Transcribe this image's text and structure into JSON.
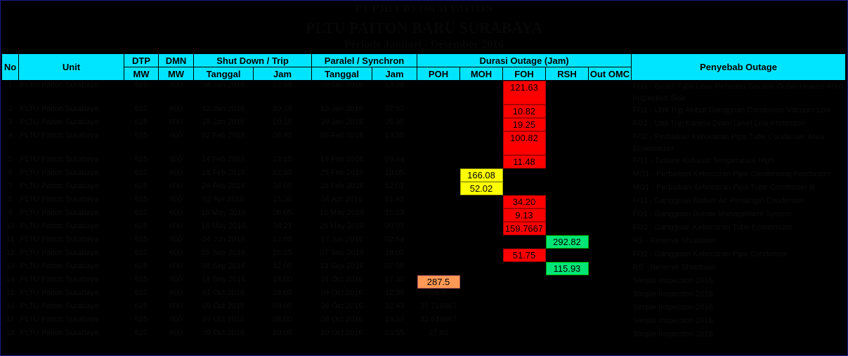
{
  "titles": {
    "line1": "PT PJB UBJ O&M PAITON",
    "line2": "PLTU PAITON BARU SURABAYA",
    "line3": "Periode Januari - Desember 2016"
  },
  "header": {
    "no": "No",
    "unit": "Unit",
    "dtp": "DTP",
    "dmn": "DMN",
    "mw": "MW",
    "shutdown": "Shut Down / Trip",
    "paralel": "Paralel / Synchron",
    "durasi": "Durasi Outage (Jam)",
    "penyebab": "Penyebab Outage",
    "tanggal": "Tanggal",
    "jam": "Jam",
    "poh": "POH",
    "moh": "MOH",
    "foh": "FOH",
    "rsh": "RSH",
    "omc": "Out OMC"
  },
  "rows": [
    {
      "no": "1",
      "unit": "PLTU Paiton Surabaya",
      "dtp": "625",
      "dmn": "600",
      "sd_date": "04 Jan 2016",
      "sd_time": "12:00",
      "pa_date": "09 Jan 2016",
      "pa_time": "13:38",
      "poh": "",
      "moh": "",
      "foh": "121.63",
      "rsh": "",
      "omc": "",
      "cause": "FO1 - Boiler Tube Leak Reheater Section Outlet Header Area Inspection Side",
      "tall": true
    },
    {
      "no": "2",
      "unit": "PLTU Paiton Surabaya",
      "dtp": "625",
      "dmn": "600",
      "sd_date": "12 Jan 2016",
      "sd_time": "20:18",
      "pa_date": "13 Jan 2016",
      "pa_time": "07:07",
      "poh": "",
      "moh": "",
      "foh": "10.82",
      "rsh": "",
      "omc": "",
      "cause": "FO1 - Unit Trip Akibat Gangguan Condenser Vacuum Low",
      "tall": false
    },
    {
      "no": "3",
      "unit": "PLTU Paiton Surabaya",
      "dtp": "625",
      "dmn": "600",
      "sd_date": "28 Jan 2016",
      "sd_time": "10:15",
      "pa_date": "29 Jan 2016",
      "pa_time": "05:30",
      "poh": "",
      "moh": "",
      "foh": "19.25",
      "rsh": "",
      "omc": "",
      "cause": "FO1 - Unit Trip Karena Drum Level Low Protection",
      "tall": false
    },
    {
      "no": "4",
      "unit": "PLTU Paiton Surabaya",
      "dtp": "625",
      "dmn": "600",
      "sd_date": "02 Feb 2016",
      "sd_time": "08:47",
      "pa_date": "06 Feb 2016",
      "pa_time": "13:36",
      "poh": "",
      "moh": "",
      "foh": "100.82",
      "rsh": "",
      "omc": "",
      "cause": "FO2 - Perbaikan Kebocoran Pipa Tube Condenser Area Economizer",
      "tall": true
    },
    {
      "no": "5",
      "unit": "PLTU Paiton Surabaya",
      "dtp": "625",
      "dmn": "600",
      "sd_date": "14 Feb 2016",
      "sd_time": "22:15",
      "pa_date": "15 Feb 2016",
      "pa_time": "09:44",
      "poh": "",
      "moh": "",
      "foh": "11.48",
      "rsh": "",
      "omc": "",
      "cause": "FO1 - Turbine Exhaust Temperature High",
      "tall": false
    },
    {
      "no": "6",
      "unit": "PLTU Paiton Surabaya",
      "dtp": "625",
      "dmn": "600",
      "sd_date": "18 Feb 2016",
      "sd_time": "12:00",
      "pa_date": "25 Feb 2016",
      "pa_time": "10:05",
      "poh": "",
      "moh": "166.08",
      "foh": "",
      "rsh": "",
      "omc": "",
      "cause": "MO1 - Perbaikan Kebocoran Pipa Condensing Feedwater",
      "tall": false
    },
    {
      "no": "7",
      "unit": "PLTU Paiton Surabaya",
      "dtp": "625",
      "dmn": "600",
      "sd_date": "26 Feb 2016",
      "sd_time": "08:00",
      "pa_date": "28 Feb 2016",
      "pa_time": "12:01",
      "poh": "",
      "moh": "52.02",
      "foh": "",
      "rsh": "",
      "omc": "",
      "cause": "MO1 - Perbaikan Kebocoran Pipa Tube Condenser B",
      "tall": false
    },
    {
      "no": "8",
      "unit": "PLTU Paiton Surabaya",
      "dtp": "625",
      "dmn": "600",
      "sd_date": "02 Apr 2016",
      "sd_time": "15:30",
      "pa_date": "04 Apr 2016",
      "pa_time": "01:42",
      "poh": "",
      "moh": "",
      "foh": "34.20",
      "rsh": "",
      "omc": "",
      "cause": "FO1 - Gangguan Sistem Air Pendingin Condenser",
      "tall": false
    },
    {
      "no": "9",
      "unit": "PLTU Paiton Surabaya",
      "dtp": "625",
      "dmn": "600",
      "sd_date": "10 May 2016",
      "sd_time": "06:05",
      "pa_date": "10 May 2016",
      "pa_time": "15:13",
      "poh": "",
      "moh": "",
      "foh": "9.13",
      "rsh": "",
      "omc": "",
      "cause": "FO1 - Gangguan Burner Management System",
      "tall": false
    },
    {
      "no": "10",
      "unit": "PLTU Paiton Surabaya",
      "dtp": "625",
      "dmn": "600",
      "sd_date": "18 May 2016",
      "sd_time": "08:21",
      "pa_date": "25 May 2016",
      "pa_time": "00:07",
      "poh": "",
      "moh": "",
      "foh": "159.7667",
      "rsh": "",
      "omc": "",
      "cause": "FO2 - Gangguan Kebocoran Tube Economizer",
      "tall": false
    },
    {
      "no": "11",
      "unit": "PLTU Paiton Surabaya",
      "dtp": "625",
      "dmn": "600",
      "sd_date": "04 Jun 2016",
      "sd_time": "22:05",
      "pa_date": "17 Jun 2016",
      "pa_time": "02:54",
      "poh": "",
      "moh": "",
      "foh": "",
      "rsh": "292.82",
      "omc": "",
      "cause": "RS - Reserve Shutdown",
      "tall": false
    },
    {
      "no": "12",
      "unit": "PLTU Paiton Surabaya",
      "dtp": "625",
      "dmn": "600",
      "sd_date": "05 Sep 2016",
      "sd_time": "15:15",
      "pa_date": "07 Sep 2016",
      "pa_time": "19:00",
      "poh": "",
      "moh": "",
      "foh": "51.75",
      "rsh": "",
      "omc": "",
      "cause": "FO2 - Gangguan Kebocoran Pipa Condenser",
      "tall": false
    },
    {
      "no": "13",
      "unit": "PLTU Paiton Surabaya",
      "dtp": "625",
      "dmn": "600",
      "sd_date": "08 Sep 2016",
      "sd_time": "12:00",
      "pa_date": "13 Sep 2016",
      "pa_time": "07:56",
      "poh": "",
      "moh": "",
      "foh": "",
      "rsh": "115.93",
      "omc": "",
      "cause": "RS - Reserve Shutdown",
      "tall": false
    },
    {
      "no": "14",
      "unit": "PLTU Paiton Surabaya",
      "dtp": "625",
      "dmn": "600",
      "sd_date": "19 Sep 2016",
      "sd_time": "18:00",
      "pa_date": "01 Oct 2016",
      "pa_time": "17:30",
      "poh": "287.5",
      "moh": "",
      "foh": "",
      "rsh": "",
      "omc": "",
      "cause": "Simple Inspection 2016",
      "tall": false
    },
    {
      "no": "15",
      "unit": "PLTU Paiton Surabaya",
      "dtp": "625",
      "dmn": "600",
      "sd_date": "01 Oct 2016",
      "sd_time": "18:00",
      "pa_date": "04 Oct 2016",
      "pa_time": "12:36",
      "poh": "66.6",
      "moh": "",
      "foh": "",
      "rsh": "",
      "omc": "",
      "cause": "Simple Inspection 2016",
      "tall": false
    },
    {
      "no": "16",
      "unit": "PLTU Paiton Surabaya",
      "dtp": "625",
      "dmn": "600",
      "sd_date": "05 Oct 2016",
      "sd_time": "09:00",
      "pa_date": "06 Oct 2016",
      "pa_time": "22:43",
      "poh": "37.716667",
      "moh": "",
      "foh": "",
      "rsh": "",
      "omc": "",
      "cause": "Simple Inspection 2016",
      "tall": false
    },
    {
      "no": "17",
      "unit": "PLTU Paiton Surabaya",
      "dtp": "625",
      "dmn": "600",
      "sd_date": "07 Oct 2016",
      "sd_time": "08:00",
      "pa_date": "08 Oct 2016",
      "pa_time": "16:37",
      "poh": "32.616667",
      "moh": "",
      "foh": "",
      "rsh": "",
      "omc": "",
      "cause": "Simple Inspection 2016",
      "tall": false
    },
    {
      "no": "18",
      "unit": "PLTU Paiton Surabaya",
      "dtp": "625",
      "dmn": "600",
      "sd_date": "09 Oct 2016",
      "sd_time": "10:00",
      "pa_date": "10 Oct 2016",
      "pa_time": "13:55",
      "poh": "27.92",
      "moh": "",
      "foh": "",
      "rsh": "",
      "omc": "",
      "cause": "Simple Inspection 2016",
      "tall": false
    }
  ],
  "colors": {
    "header": "#00e5ff",
    "foh": "#ff0000",
    "moh": "#ffff00",
    "rsh": "#00e676",
    "poh": "#ff9955"
  }
}
